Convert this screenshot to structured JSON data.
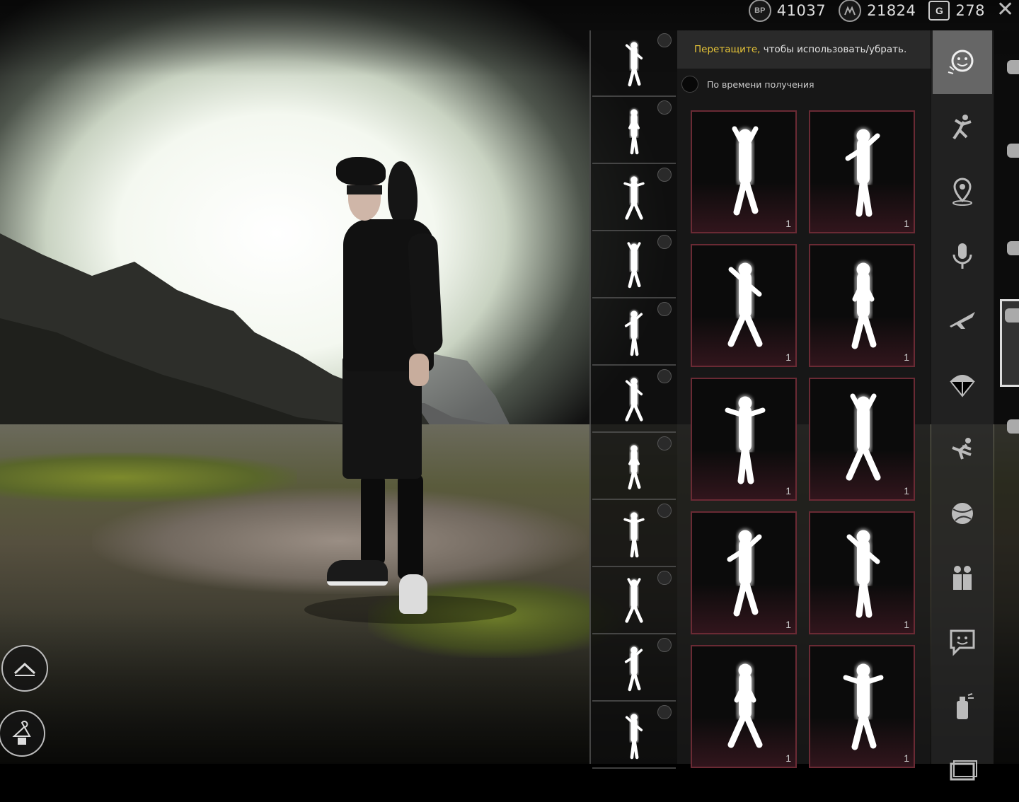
{
  "currency": {
    "bp": {
      "icon": "bp-coin-icon",
      "label": "BP",
      "value": "41037"
    },
    "silver": {
      "icon": "silver-fragment-icon",
      "value": "21824"
    },
    "gcoin": {
      "icon": "g-coin-icon",
      "label": "G",
      "value": "278"
    }
  },
  "hint": {
    "accent": "Перетащите,",
    "rest": " чтобы использовать/убрать."
  },
  "sort": {
    "label": "По времени получения"
  },
  "equipped_slots": [
    {
      "pose": "flex-pose"
    },
    {
      "pose": "monster-pose"
    },
    {
      "pose": "crawl-pose"
    },
    {
      "pose": "muscle-pose"
    },
    {
      "pose": "lean-pose"
    },
    {
      "pose": "point-pose"
    },
    {
      "pose": "wave-pose"
    },
    {
      "pose": "bow-pose"
    },
    {
      "pose": "stand-pose"
    },
    {
      "pose": "dance-pose"
    },
    {
      "pose": "reach-pose"
    }
  ],
  "inventory": [
    {
      "pose": "hip-sway",
      "count": "1"
    },
    {
      "pose": "stand-tall",
      "count": "1"
    },
    {
      "pose": "idle",
      "count": "1"
    },
    {
      "pose": "head-hold",
      "count": "1"
    },
    {
      "pose": "guitar-dance",
      "count": "1"
    },
    {
      "pose": "hands-on-hips",
      "count": "1"
    },
    {
      "pose": "heart-hands",
      "count": "1"
    },
    {
      "pose": "partner-lift",
      "count": "1"
    },
    {
      "pose": "shimmy",
      "count": "1"
    },
    {
      "pose": "mic-sing",
      "count": "1"
    }
  ],
  "categories": [
    {
      "icon": "emote-face-icon",
      "active": true
    },
    {
      "icon": "throw-pose-icon"
    },
    {
      "icon": "map-marker-icon"
    },
    {
      "icon": "microphone-icon"
    },
    {
      "icon": "airplane-icon"
    },
    {
      "icon": "parachute-icon"
    },
    {
      "icon": "fall-pose-icon"
    },
    {
      "icon": "ball-icon"
    },
    {
      "icon": "friends-icon"
    },
    {
      "icon": "chat-bubble-icon"
    },
    {
      "icon": "spray-can-icon"
    },
    {
      "icon": "card-icon"
    }
  ],
  "edge_tabs": [
    {
      "icon": "character-hat-icon"
    },
    {
      "icon": "gun-icon"
    },
    {
      "icon": "steering-wheel-icon"
    },
    {
      "icon": "emote-tab-icon",
      "active": true
    },
    {
      "icon": "crate-icon"
    }
  ],
  "bottom_buttons": [
    {
      "icon": "chevron-up-icon"
    },
    {
      "icon": "wardrobe-hanger-icon"
    }
  ]
}
